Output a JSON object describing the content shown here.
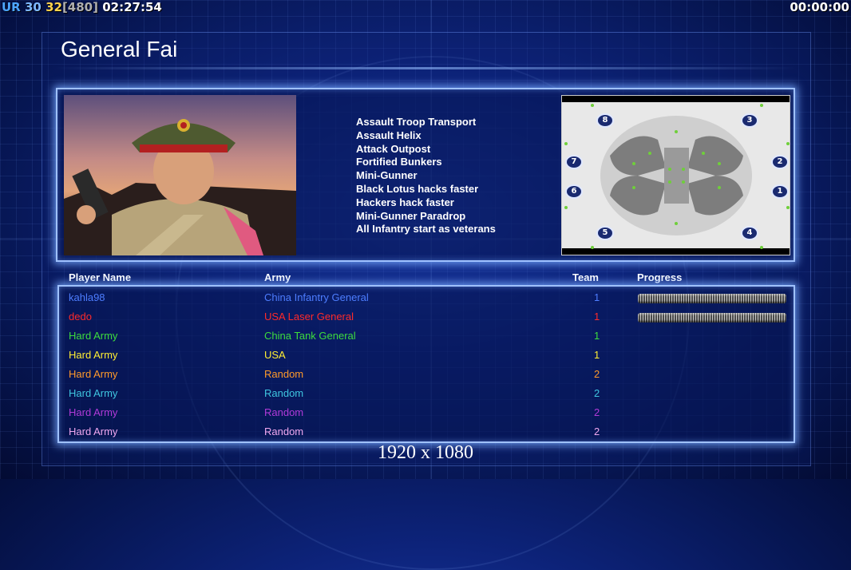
{
  "hud": {
    "left": {
      "label": "UR",
      "value_a": "30",
      "value_b": "32",
      "bracket": "[480]",
      "clock": "02:27:54"
    },
    "right_clock": "00:00:00"
  },
  "title": "General Fai",
  "bonuses": [
    "Assault Troop Transport",
    "Assault Helix",
    "Attack Outpost",
    "Fortified Bunkers",
    "Mini-Gunner",
    "Black Lotus hacks faster",
    "Hackers hack faster",
    "Mini-Gunner Paradrop",
    "All Infantry start as veterans"
  ],
  "minimap_slots": [
    "8",
    "3",
    "7",
    "2",
    "6",
    "1",
    "5",
    "4"
  ],
  "table": {
    "headers": {
      "player": "Player Name",
      "army": "Army",
      "team": "Team",
      "progress": "Progress"
    },
    "rows": [
      {
        "name": "kahla98",
        "army": "China Infantry General",
        "team": "1",
        "color": "#4d7dff",
        "progress": 1.0
      },
      {
        "name": "dedo",
        "army": "USA Laser General",
        "team": "1",
        "color": "#ff2a2a",
        "progress": 1.0
      },
      {
        "name": "Hard Army",
        "army": "China Tank General",
        "team": "1",
        "color": "#3ddc3d",
        "progress": null
      },
      {
        "name": "Hard Army",
        "army": "USA",
        "team": "1",
        "color": "#ffee33",
        "progress": null
      },
      {
        "name": "Hard Army",
        "army": "Random",
        "team": "2",
        "color": "#ff9a2a",
        "progress": null
      },
      {
        "name": "Hard Army",
        "army": "Random",
        "team": "2",
        "color": "#3fc6e0",
        "progress": null
      },
      {
        "name": "Hard Army",
        "army": "Random",
        "team": "2",
        "color": "#b23ad9",
        "progress": null
      },
      {
        "name": "Hard Army",
        "army": "Random",
        "team": "2",
        "color": "#f0a8f0",
        "progress": null
      }
    ]
  },
  "resolution": "1920 x 1080"
}
